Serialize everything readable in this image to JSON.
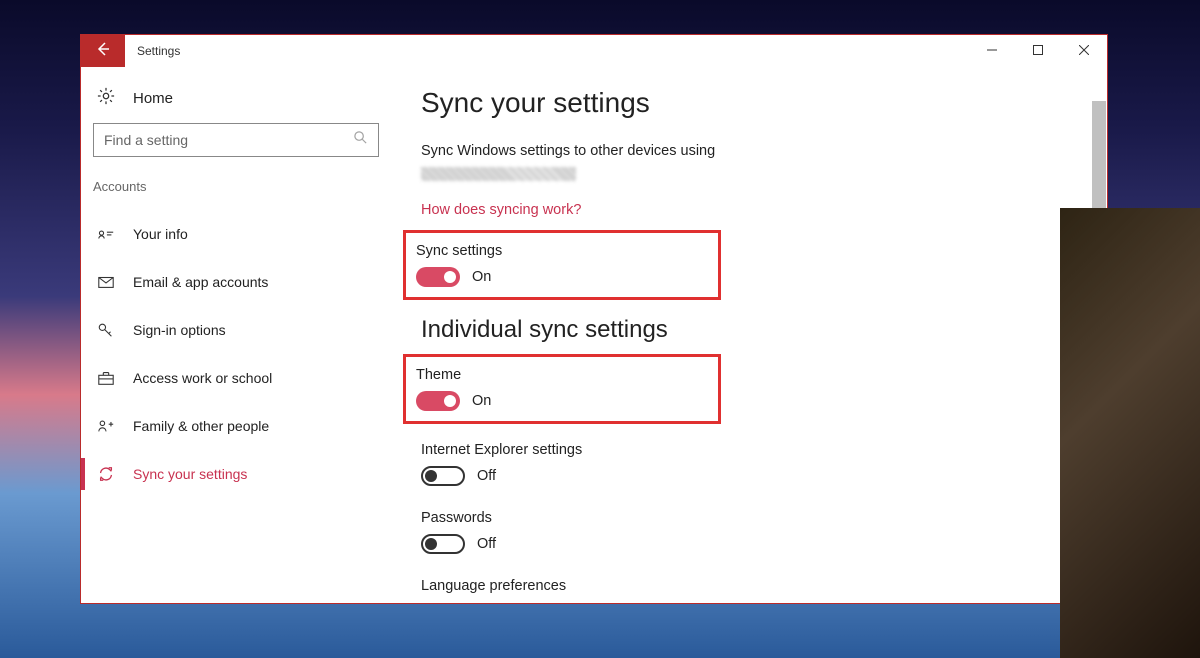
{
  "window": {
    "title": "Settings"
  },
  "sidebar": {
    "home_label": "Home",
    "search_placeholder": "Find a setting",
    "category_label": "Accounts",
    "items": [
      {
        "label": "Your info"
      },
      {
        "label": "Email & app accounts"
      },
      {
        "label": "Sign-in options"
      },
      {
        "label": "Access work or school"
      },
      {
        "label": "Family & other people"
      },
      {
        "label": "Sync your settings"
      }
    ]
  },
  "content": {
    "page_heading": "Sync your settings",
    "description": "Sync Windows settings to other devices using",
    "help_link": "How does syncing work?",
    "sync_settings": {
      "label": "Sync settings",
      "state": "On"
    },
    "individual_heading": "Individual sync settings",
    "individual": {
      "theme": {
        "label": "Theme",
        "state": "On"
      },
      "ie": {
        "label": "Internet Explorer settings",
        "state": "Off"
      },
      "passwd": {
        "label": "Passwords",
        "state": "Off"
      },
      "lang": {
        "label": "Language preferences",
        "state": ""
      }
    }
  }
}
